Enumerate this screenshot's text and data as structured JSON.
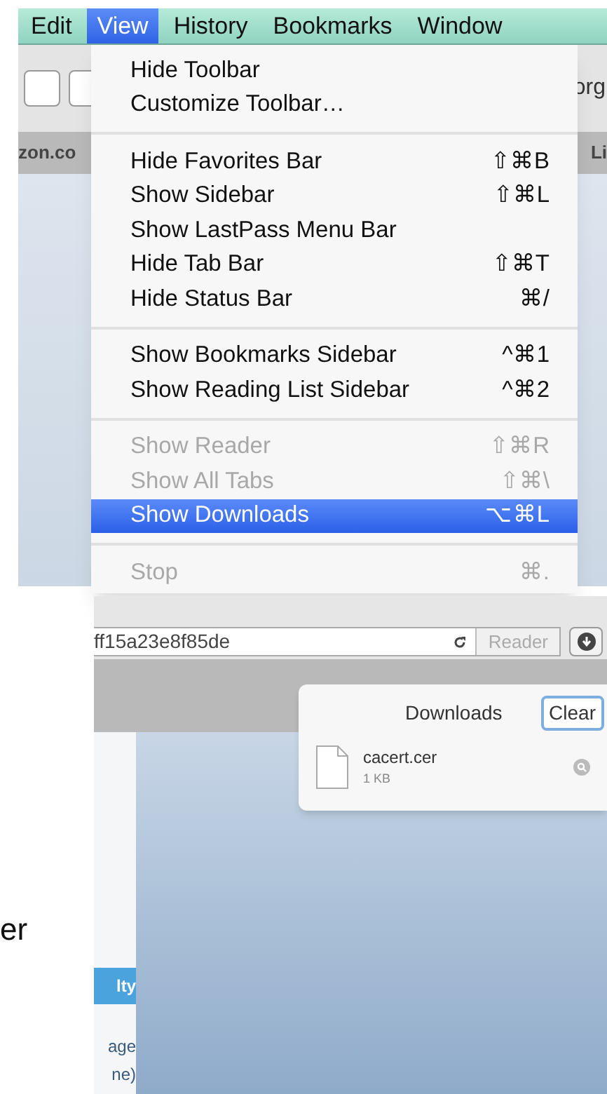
{
  "menu_bar": [
    {
      "label": "Edit",
      "selected": false
    },
    {
      "label": "View",
      "selected": true
    },
    {
      "label": "History",
      "selected": false
    },
    {
      "label": "Bookmarks",
      "selected": false
    },
    {
      "label": "Window",
      "selected": false
    }
  ],
  "background": {
    "address_fragment": "org",
    "bookmark_left": "zon.co",
    "bookmark_right": "Li"
  },
  "menu": {
    "items": [
      {
        "kind": "item",
        "label": "Hide Toolbar",
        "disabled": false,
        "selected": false
      },
      {
        "kind": "item",
        "label": "Customize Toolbar…",
        "disabled": false,
        "selected": false
      },
      {
        "kind": "separator"
      },
      {
        "kind": "item",
        "label": "Hide Favorites Bar",
        "shortcut": "⇧⌘B",
        "disabled": false,
        "selected": false
      },
      {
        "kind": "item",
        "label": "Show Sidebar",
        "shortcut": "⇧⌘L",
        "disabled": false,
        "selected": false
      },
      {
        "kind": "item",
        "label": "Show LastPass Menu Bar",
        "disabled": false,
        "selected": false
      },
      {
        "kind": "item",
        "label": "Hide Tab Bar",
        "shortcut": "⇧⌘T",
        "disabled": false,
        "selected": false
      },
      {
        "kind": "item",
        "label": "Hide Status Bar",
        "shortcut": "⌘/",
        "disabled": false,
        "selected": false
      },
      {
        "kind": "separator"
      },
      {
        "kind": "item",
        "label": "Show Bookmarks Sidebar",
        "shortcut": "^⌘1",
        "disabled": false,
        "selected": false
      },
      {
        "kind": "item",
        "label": "Show Reading List Sidebar",
        "shortcut": "^⌘2",
        "disabled": false,
        "selected": false
      },
      {
        "kind": "separator"
      },
      {
        "kind": "item",
        "label": "Show Reader",
        "shortcut": "⇧⌘R",
        "disabled": true,
        "selected": false
      },
      {
        "kind": "item",
        "label": "Show All Tabs",
        "shortcut": "⇧⌘\\",
        "disabled": true,
        "selected": false
      },
      {
        "kind": "item",
        "label": "Show Downloads",
        "shortcut": "⌥⌘L",
        "disabled": false,
        "selected": true
      },
      {
        "kind": "separator"
      },
      {
        "kind": "item",
        "label": "Stop",
        "shortcut": "⌘.",
        "disabled": true,
        "selected": false
      }
    ]
  },
  "document_text": "er",
  "browser": {
    "url": "ff15a23e8f85de",
    "reader_button": "Reader",
    "downloads": {
      "title": "Downloads",
      "clear_button": "Clear",
      "items": [
        {
          "name": "cacert.cer",
          "size": "1 KB"
        }
      ]
    },
    "page": {
      "band": "lty",
      "lines": [
        "age",
        "ne)"
      ]
    }
  }
}
